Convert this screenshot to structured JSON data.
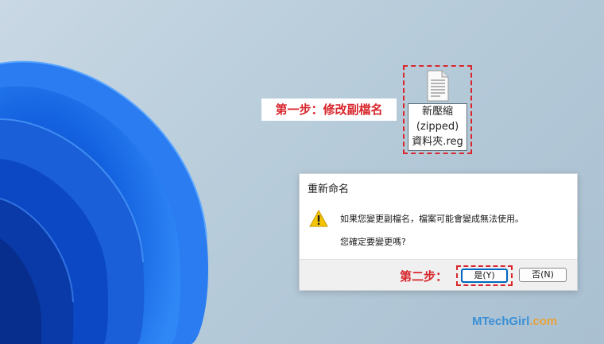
{
  "desktop": {
    "file": {
      "name_lines": [
        "新壓縮",
        "(zipped)",
        "資料夾.reg"
      ],
      "icon": "text-document-icon"
    },
    "step1_label": "第一步：修改副檔名",
    "colors": {
      "annotation": "#d8262c",
      "accent": "#0067c0"
    }
  },
  "dialog": {
    "title": "重新命名",
    "icon": "warning-icon",
    "message": "如果您變更副檔名，檔案可能會變成無法使用。",
    "question": "您確定要變更嗎?",
    "step2_label": "第二步：",
    "yes_label": "是(Y)",
    "no_label": "否(N)"
  },
  "watermark": {
    "part1": "MTechGirl",
    "part2": ".com"
  }
}
